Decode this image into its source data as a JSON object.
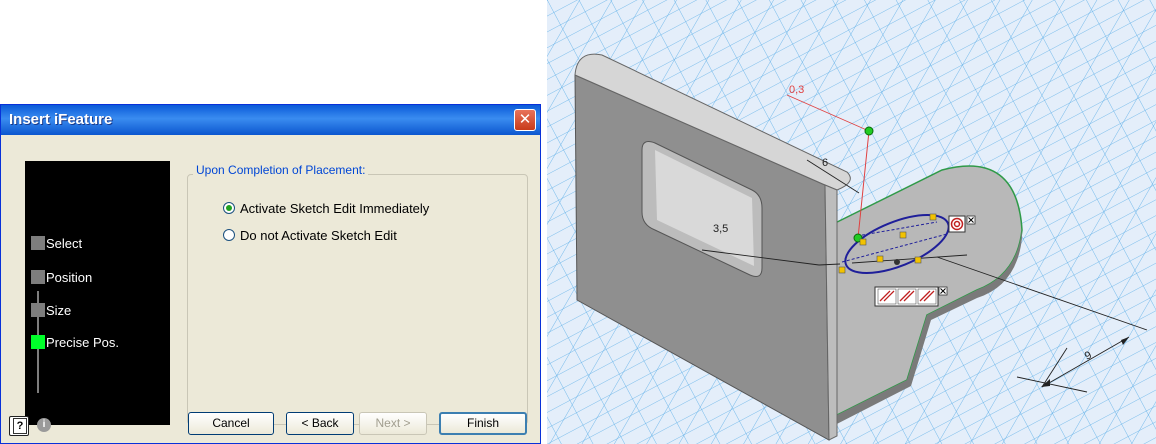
{
  "dialog": {
    "title": "Insert iFeature",
    "steps": [
      {
        "label": "Select",
        "active": false
      },
      {
        "label": "Position",
        "active": false
      },
      {
        "label": "Size",
        "active": false
      },
      {
        "label": "Precise Pos.",
        "active": true
      }
    ],
    "completion_group": {
      "legend": "Upon Completion of Placement:",
      "options": [
        {
          "label": "Activate Sketch Edit Immediately",
          "checked": true
        },
        {
          "label": "Do not Activate Sketch Edit",
          "checked": false
        }
      ]
    },
    "buttons": {
      "cancel": "Cancel",
      "back": "< Back",
      "next": "Next >",
      "finish": "Finish"
    },
    "help_glyph": "?",
    "info_glyph": "i"
  },
  "viewport": {
    "dimensions": {
      "d1": "0,3",
      "d2": "6",
      "d3": "3,5",
      "d4": "9"
    },
    "colors": {
      "grid": "#4aa3e0",
      "part": "#a9a9a9",
      "sketch": "#1f1f9a",
      "dimension_red": "#e04040",
      "active_step": "#00ff2a"
    },
    "icons": [
      "concentric-constraint-icon",
      "parallel-constraint-icon",
      "close-glyph-icon"
    ]
  }
}
